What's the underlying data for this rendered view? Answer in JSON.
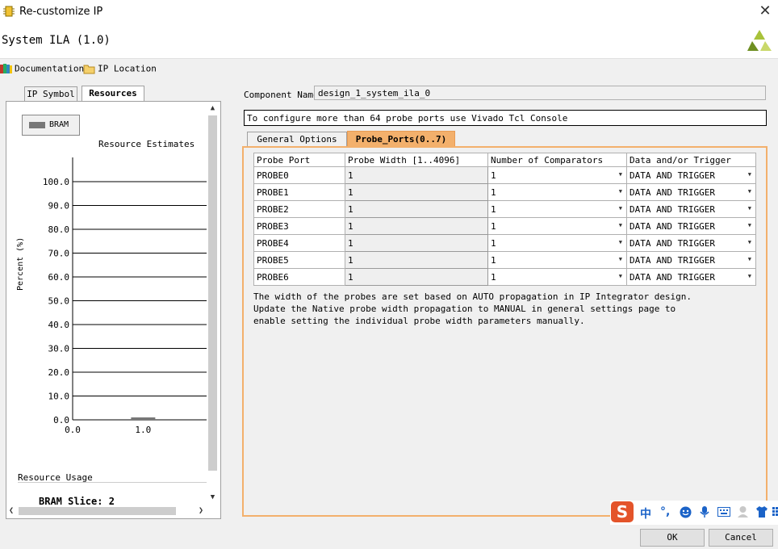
{
  "window": {
    "title": "Re-customize IP",
    "close_label": "✕"
  },
  "ip": {
    "title": "System ILA (1.0)"
  },
  "toolbar": {
    "documentation": "Documentation",
    "ip_location": "IP Location"
  },
  "left_tabs": [
    {
      "label": "IP Symbol"
    },
    {
      "label": "Resources"
    }
  ],
  "legend": {
    "label": "BRAM"
  },
  "chart_data": {
    "type": "bar",
    "title": "Resource Estimates",
    "ylabel": "Percent (%)",
    "xlabel": "",
    "ylim": [
      0,
      100
    ],
    "y_ticks": [
      "0.0",
      "10.0",
      "20.0",
      "30.0",
      "40.0",
      "50.0",
      "60.0",
      "70.0",
      "80.0",
      "90.0",
      "100.0"
    ],
    "x_ticks": [
      "0.0",
      "1.0"
    ],
    "series": [
      {
        "name": "BRAM",
        "x": [
          1.0
        ],
        "values": [
          0.8
        ]
      }
    ],
    "grid": true,
    "legend_position": "top-left"
  },
  "usage": {
    "label": "Resource Usage",
    "bram_slice": "BRAM Slice: 2"
  },
  "component": {
    "label": "Component Name",
    "value": "design_1_system_ila_0"
  },
  "info": "To configure more than 64 probe ports use Vivado Tcl Console",
  "right_tabs": [
    {
      "label": "General Options"
    },
    {
      "label": "Probe_Ports(0..7)"
    }
  ],
  "table": {
    "headers": [
      "Probe Port",
      "Probe Width [1..4096]",
      "Number of Comparators",
      "Data and/or Trigger"
    ],
    "rows": [
      {
        "port": "PROBE0",
        "width": "1",
        "comparators": "1",
        "trigger": "DATA AND TRIGGER"
      },
      {
        "port": "PROBE1",
        "width": "1",
        "comparators": "1",
        "trigger": "DATA AND TRIGGER"
      },
      {
        "port": "PROBE2",
        "width": "1",
        "comparators": "1",
        "trigger": "DATA AND TRIGGER"
      },
      {
        "port": "PROBE3",
        "width": "1",
        "comparators": "1",
        "trigger": "DATA AND TRIGGER"
      },
      {
        "port": "PROBE4",
        "width": "1",
        "comparators": "1",
        "trigger": "DATA AND TRIGGER"
      },
      {
        "port": "PROBE5",
        "width": "1",
        "comparators": "1",
        "trigger": "DATA AND TRIGGER"
      },
      {
        "port": "PROBE6",
        "width": "1",
        "comparators": "1",
        "trigger": "DATA AND TRIGGER"
      }
    ]
  },
  "notes": [
    "The width of the probes are set based on AUTO propagation in IP Integrator design.",
    "Update the Native probe width propagation to MANUAL in general settings page to",
    "enable setting the individual probe width parameters manually."
  ],
  "tray": {
    "sogou": "S",
    "chinese": "中",
    "punct": "°,"
  },
  "buttons": {
    "ok": "OK",
    "cancel": "Cancel"
  },
  "colors": {
    "accent_tab": "#f3b06c",
    "panel_border": "#f3b06c",
    "bar": "#777777",
    "sogou": "#e4542a"
  },
  "icons": [
    "app-ip-icon",
    "close-icon",
    "xilinx-logo",
    "documentation-icon",
    "folder-icon",
    "chevron-up-icon",
    "chevron-down-icon",
    "chevron-left-icon",
    "chevron-right-icon",
    "dropdown-arrow-icon",
    "emoji-icon",
    "mic-icon",
    "keyboard-icon",
    "user-icon",
    "shirt-icon",
    "grid-icon"
  ]
}
